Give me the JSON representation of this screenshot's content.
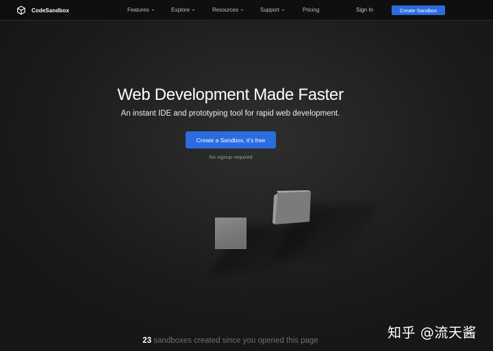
{
  "brand": {
    "name": "CodeSandbox",
    "logo_icon": "codesandbox-cube-icon"
  },
  "nav": {
    "items": [
      {
        "label": "Features",
        "has_dropdown": true
      },
      {
        "label": "Explore",
        "has_dropdown": true
      },
      {
        "label": "Resources",
        "has_dropdown": true
      },
      {
        "label": "Support",
        "has_dropdown": true
      },
      {
        "label": "Pricing",
        "has_dropdown": false
      }
    ],
    "sign_in": "Sign In",
    "cta": "Create Sandbox"
  },
  "hero": {
    "title": "Web Development Made Faster",
    "subtitle": "An instant IDE and prototyping tool for rapid web development.",
    "cta": "Create a Sandbox, it’s free",
    "note": "No signup required"
  },
  "counter": {
    "count": "23",
    "text": " sandboxes created since you opened this page"
  },
  "watermark": "知乎 @流天酱",
  "colors": {
    "accent": "#2b6de0",
    "nav_bg": "#0f0f0f",
    "page_bg": "#1a1a1a"
  }
}
